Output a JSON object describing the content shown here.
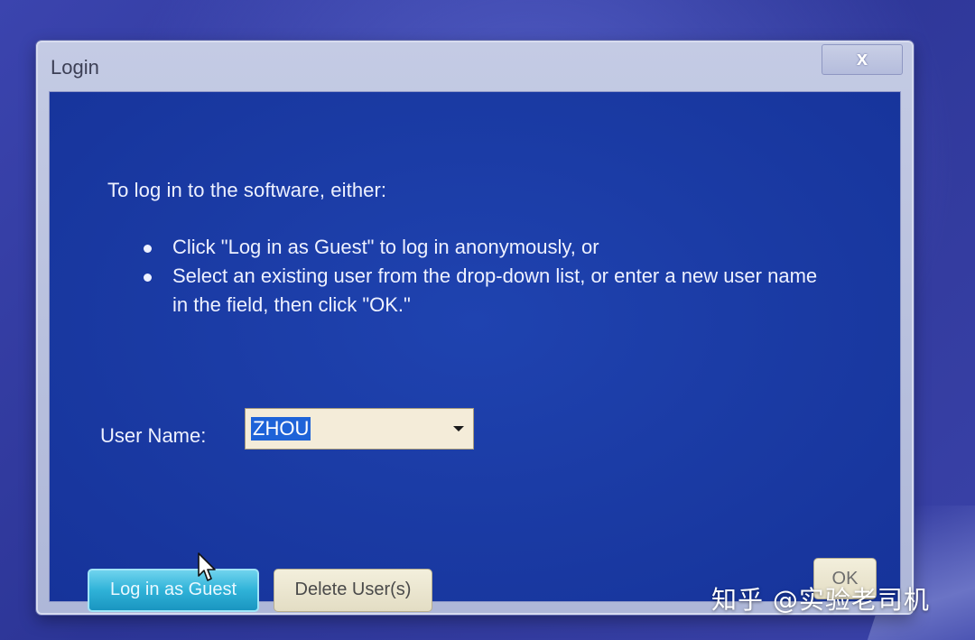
{
  "window": {
    "title": "Login",
    "close_glyph": "x"
  },
  "instructions": {
    "intro": "To log in to the software, either:",
    "bullets": [
      "Click \"Log in as Guest\" to log in anonymously, or",
      "Select an existing user from the drop-down list, or enter a new user name in the field, then click \"OK.\""
    ]
  },
  "user_name": {
    "label": "User Name:",
    "value": "ZHOU"
  },
  "buttons": {
    "guest": "Log in as Guest",
    "delete": "Delete User(s)",
    "ok": "OK"
  },
  "watermark": "知乎 @实验老司机",
  "colors": {
    "client_bg": "#1a3aa3",
    "guest_button": "#2fb2d8",
    "selection": "#1e63d8"
  }
}
